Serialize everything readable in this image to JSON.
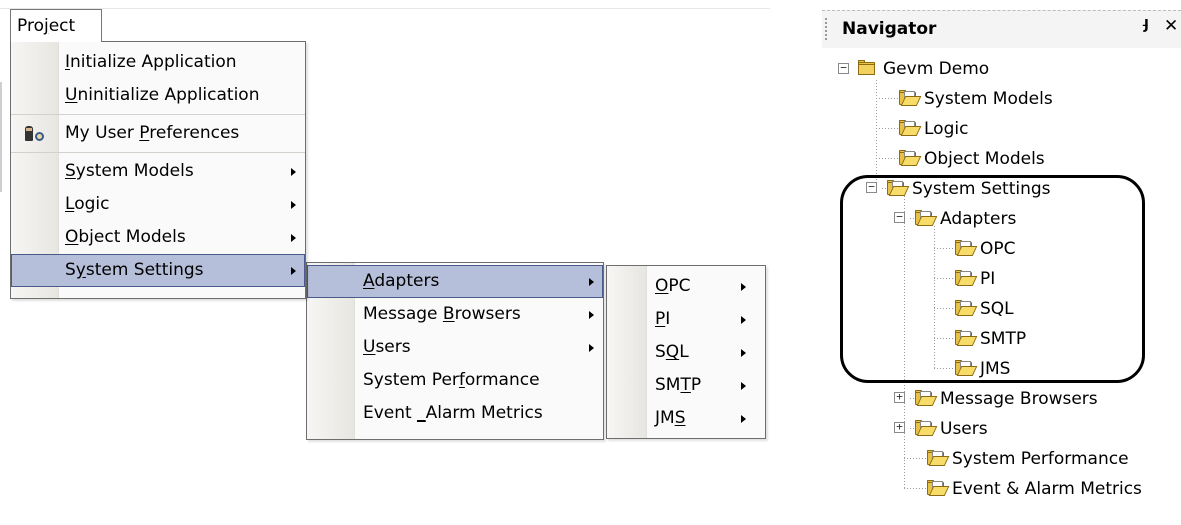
{
  "menubar": {
    "project_label": "Project",
    "project_mnemonic": "j"
  },
  "project_menu": {
    "items": [
      {
        "pre": "",
        "key": "I",
        "post": "nitialize Application"
      },
      {
        "pre": "",
        "key": "U",
        "post": "ninitialize Application"
      },
      {
        "pre": "My User ",
        "key": "P",
        "post": "references"
      },
      {
        "pre": "",
        "key": "S",
        "post": "ystem Models"
      },
      {
        "pre": "",
        "key": "L",
        "post": "ogic"
      },
      {
        "pre": "",
        "key": "O",
        "post": "bject Models"
      },
      {
        "pre": "S",
        "key": "y",
        "post": "stem Settings"
      }
    ]
  },
  "adapters_menu": {
    "items": [
      {
        "pre": "",
        "key": "A",
        "post": "dapters"
      },
      {
        "pre": "Message ",
        "key": "B",
        "post": "rowsers"
      },
      {
        "pre": "",
        "key": "U",
        "post": "sers"
      },
      {
        "pre": "System Per",
        "key": "f",
        "post": "ormance"
      },
      {
        "pre": "Event ",
        "key": "_",
        "post": "Alarm Metrics"
      }
    ]
  },
  "protocol_menu": {
    "items": [
      {
        "pre": "",
        "key": "O",
        "post": "PC"
      },
      {
        "pre": "",
        "key": "P",
        "post": "I"
      },
      {
        "pre": "S",
        "key": "Q",
        "post": "L"
      },
      {
        "pre": "SM",
        "key": "T",
        "post": "P"
      },
      {
        "pre": "JM",
        "key": "S",
        "post": ""
      }
    ]
  },
  "navigator": {
    "title": "Navigator",
    "pin_icon": "pin-icon",
    "close_icon": "close-icon",
    "tree": [
      {
        "label": "Gevm Demo"
      },
      {
        "label": "System Models"
      },
      {
        "label": "Logic"
      },
      {
        "label": "Object Models"
      },
      {
        "label": "System Settings"
      },
      {
        "label": "Adapters"
      },
      {
        "label": "OPC"
      },
      {
        "label": "PI"
      },
      {
        "label": "SQL"
      },
      {
        "label": "SMTP"
      },
      {
        "label": "JMS"
      },
      {
        "label": "Message Browsers"
      },
      {
        "label": "Users"
      },
      {
        "label": "System Performance"
      },
      {
        "label": "Event & Alarm Metrics"
      }
    ]
  },
  "colors": {
    "highlight": "#b6bfd9",
    "highlight_border": "#4a5a8a",
    "folder": "#f3d15e"
  }
}
